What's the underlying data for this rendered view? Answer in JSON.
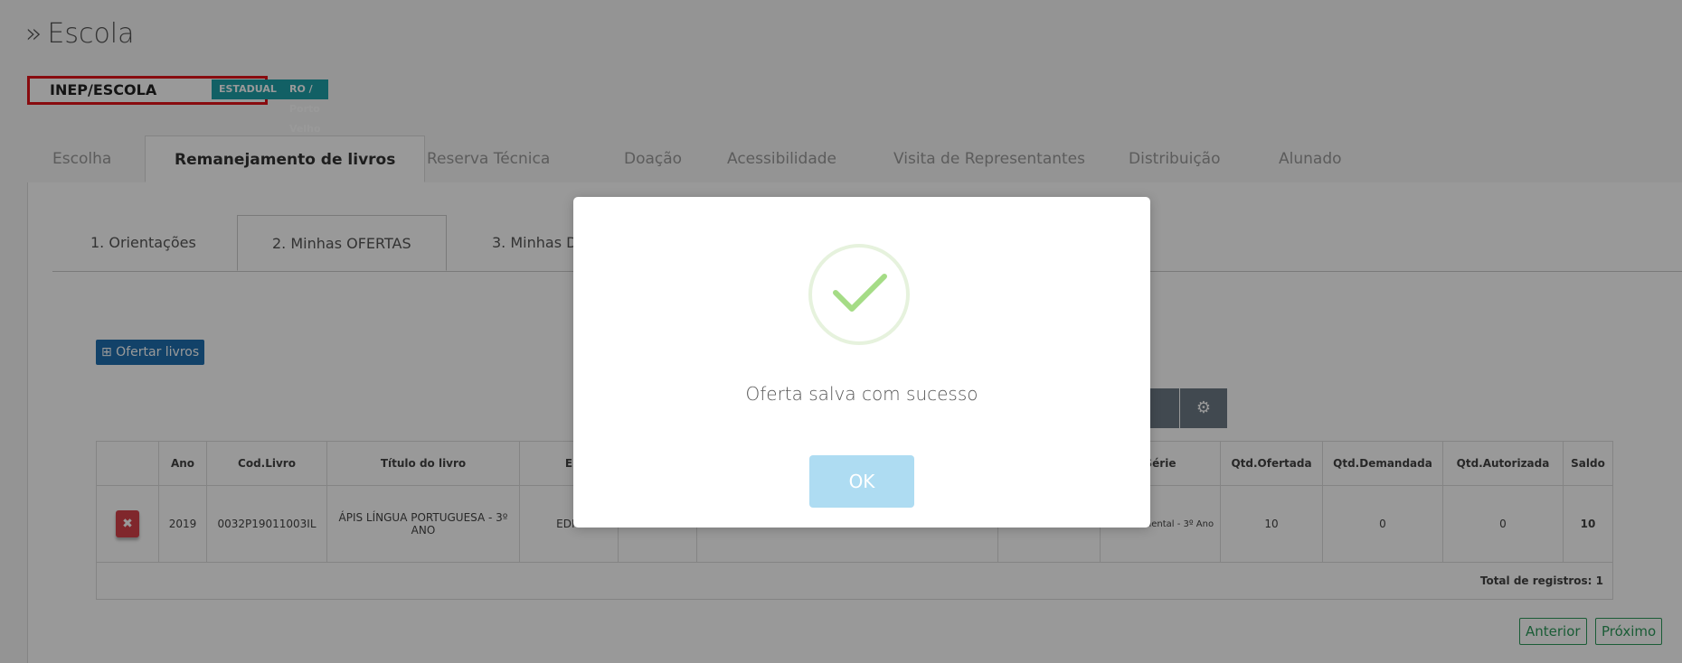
{
  "header": {
    "chevron": "»",
    "title": "Escola",
    "inep_label": "INEP/ESCOLA",
    "badge_rede": "ESTADUAL",
    "badge_local": "RO / Porto Velho"
  },
  "main_tabs": [
    {
      "label": "Escolha"
    },
    {
      "label": "Remanejamento de livros"
    },
    {
      "label": "Reserva Técnica"
    },
    {
      "label": "Doação"
    },
    {
      "label": "Acessibilidade"
    },
    {
      "label": "Visita de Representantes"
    },
    {
      "label": "Distribuição"
    },
    {
      "label": "Alunado"
    }
  ],
  "sub_tabs": [
    {
      "label": "1. Orientações"
    },
    {
      "label": "2. Minhas OFERTAS"
    },
    {
      "label": "3. Minhas D"
    }
  ],
  "actions": {
    "ofertar_label": "⊞ Ofertar livros",
    "gear_icon": "gear-icon"
  },
  "table": {
    "headers": [
      "",
      "Ano",
      "Cod.Livro",
      "Título do livro",
      "E",
      "",
      "",
      "",
      "Série",
      "Qtd.Ofertada",
      "Qtd.Demandada",
      "Qtd.Autorizada",
      "Saldo"
    ],
    "row": {
      "delete_symbol": "✖",
      "ano": "2019",
      "cod_livro": "0032P19011003IL",
      "titulo": "ÁPIS LÍNGUA PORTUGUESA - 3º ANO",
      "editora": "EDIT",
      "serie": "o Fundamental - 3º Ano",
      "qtd_ofertada": "10",
      "qtd_demandada": "0",
      "qtd_autorizada": "0",
      "saldo": "10"
    },
    "total": "Total de registros: 1"
  },
  "pager": {
    "prev": "Anterior",
    "next": "Próximo"
  },
  "modal": {
    "message": "Oferta salva com sucesso",
    "ok_label": "OK",
    "check_color": "#a5dc86"
  }
}
